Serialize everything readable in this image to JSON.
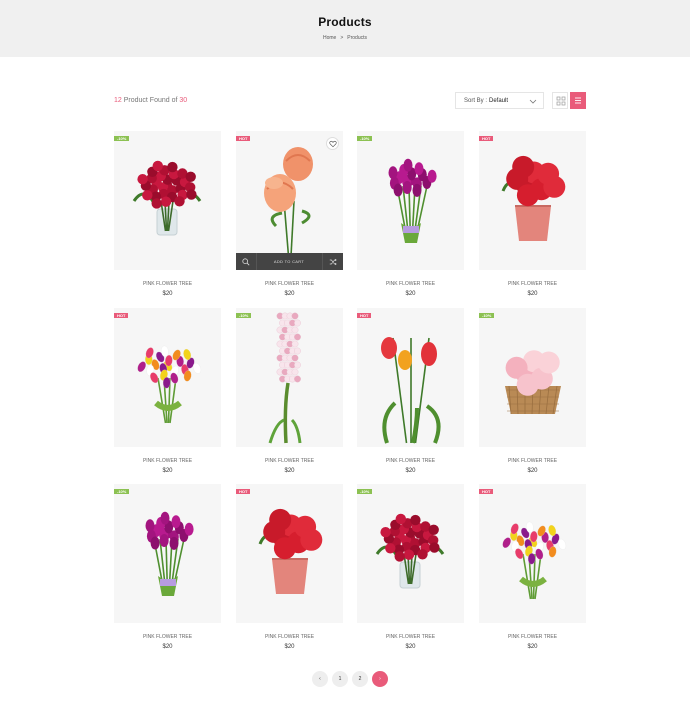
{
  "header": {
    "title": "Products",
    "breadcrumb": [
      "Home",
      "Products"
    ],
    "breadcrumb_sep": ">"
  },
  "toolbar": {
    "count_found": "12",
    "count_text_mid": " Product Found of ",
    "count_total": "30",
    "sort_label": "Sort By :",
    "sort_value": "Default",
    "views": [
      "grid-view-icon",
      "list-view-icon"
    ]
  },
  "colors": {
    "accent": "#e95b7a",
    "sale_badge": "#8cc152",
    "hot_badge": "#e95b7a"
  },
  "hover_card": {
    "add_to_cart": "ADD TO CART",
    "icons": [
      "search-icon",
      "heart-icon",
      "shuffle-icon"
    ]
  },
  "products": [
    {
      "name": "PINK FLOWER TREE",
      "price": "$20",
      "badge": "-10%",
      "badge_type": "sale",
      "image": "red-rose-vase"
    },
    {
      "name": "PINK FLOWER TREE",
      "price": "$20",
      "badge": "HOT",
      "badge_type": "hot",
      "image": "orange-roses"
    },
    {
      "name": "PINK FLOWER TREE",
      "price": "$20",
      "badge": "-10%",
      "badge_type": "sale",
      "image": "purple-tulips"
    },
    {
      "name": "PINK FLOWER TREE",
      "price": "$20",
      "badge": "HOT",
      "badge_type": "hot",
      "image": "red-roses-pot"
    },
    {
      "name": "PINK FLOWER TREE",
      "price": "$20",
      "badge": "HOT",
      "badge_type": "hot",
      "image": "mixed-tulips"
    },
    {
      "name": "PINK FLOWER TREE",
      "price": "$20",
      "badge": "-10%",
      "badge_type": "sale",
      "image": "pink-hyacinth"
    },
    {
      "name": "PINK FLOWER TREE",
      "price": "$20",
      "badge": "HOT",
      "badge_type": "hot",
      "image": "red-tulips"
    },
    {
      "name": "PINK FLOWER TREE",
      "price": "$20",
      "badge": "-10%",
      "badge_type": "sale",
      "image": "pink-roses-basket"
    },
    {
      "name": "PINK FLOWER TREE",
      "price": "$20",
      "badge": "-10%",
      "badge_type": "sale",
      "image": "purple-tulips"
    },
    {
      "name": "PINK FLOWER TREE",
      "price": "$20",
      "badge": "HOT",
      "badge_type": "hot",
      "image": "red-roses-pot"
    },
    {
      "name": "PINK FLOWER TREE",
      "price": "$20",
      "badge": "-10%",
      "badge_type": "sale",
      "image": "red-rose-vase"
    },
    {
      "name": "PINK FLOWER TREE",
      "price": "$20",
      "badge": "HOT",
      "badge_type": "hot",
      "image": "mixed-tulips"
    }
  ],
  "pagination": {
    "prev": "‹",
    "pages": [
      "1",
      "2"
    ],
    "next": "›",
    "current": "next"
  }
}
